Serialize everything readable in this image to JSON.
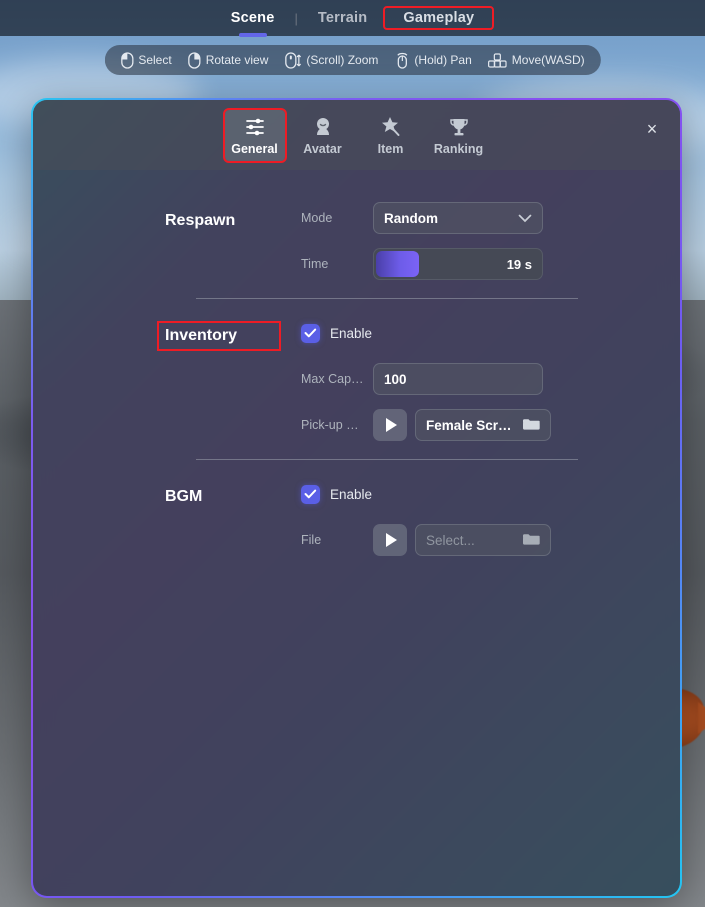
{
  "topbar": {
    "tabs": [
      {
        "label": "Scene",
        "active": true,
        "highlighted": false
      },
      {
        "label": "Terrain",
        "active": false,
        "highlighted": false
      },
      {
        "label": "Gameplay",
        "active": false,
        "highlighted": true
      }
    ],
    "separator": "|"
  },
  "hints": [
    {
      "icon": "mouse-left-click-icon",
      "label": "Select"
    },
    {
      "icon": "mouse-right-click-icon",
      "label": "Rotate view"
    },
    {
      "icon": "mouse-scroll-icon",
      "label": "(Scroll) Zoom"
    },
    {
      "icon": "mouse-hold-icon",
      "label": "(Hold) Pan"
    },
    {
      "icon": "keyboard-wasd-icon",
      "label": "Move(WASD)"
    }
  ],
  "panel": {
    "close_label": "×",
    "tabs": [
      {
        "label": "General",
        "icon": "sliders-icon",
        "active": true,
        "highlighted": true
      },
      {
        "label": "Avatar",
        "icon": "avatar-icon",
        "active": false,
        "highlighted": false
      },
      {
        "label": "Item",
        "icon": "magic-wand-icon",
        "active": false,
        "highlighted": false
      },
      {
        "label": "Ranking",
        "icon": "trophy-icon",
        "active": false,
        "highlighted": false
      }
    ],
    "sections": {
      "respawn": {
        "title": "Respawn",
        "mode": {
          "label": "Mode",
          "value": "Random"
        },
        "time": {
          "label": "Time",
          "value": "19 s",
          "fill_percent": 26
        }
      },
      "inventory": {
        "title": "Inventory",
        "highlighted": true,
        "enable": {
          "label": "Enable",
          "checked": true
        },
        "max_capacity": {
          "label": "Max Cap…",
          "value": "100"
        },
        "pickup": {
          "label": "Pick-up …",
          "value": "Female Scr…",
          "play_icon": "play-icon",
          "folder_icon": "folder-icon"
        }
      },
      "bgm": {
        "title": "BGM",
        "enable": {
          "label": "Enable",
          "checked": true
        },
        "file": {
          "label": "File",
          "placeholder": "Select...",
          "play_icon": "play-icon",
          "folder_icon": "folder-icon"
        }
      }
    }
  },
  "colors": {
    "accent_purple": "#6366e8",
    "checkbox_blue": "#5a5fe6",
    "highlight_red": "#ee1c25",
    "border_cyan": "#22c5f2",
    "panel_bg": "#3a3f48"
  }
}
